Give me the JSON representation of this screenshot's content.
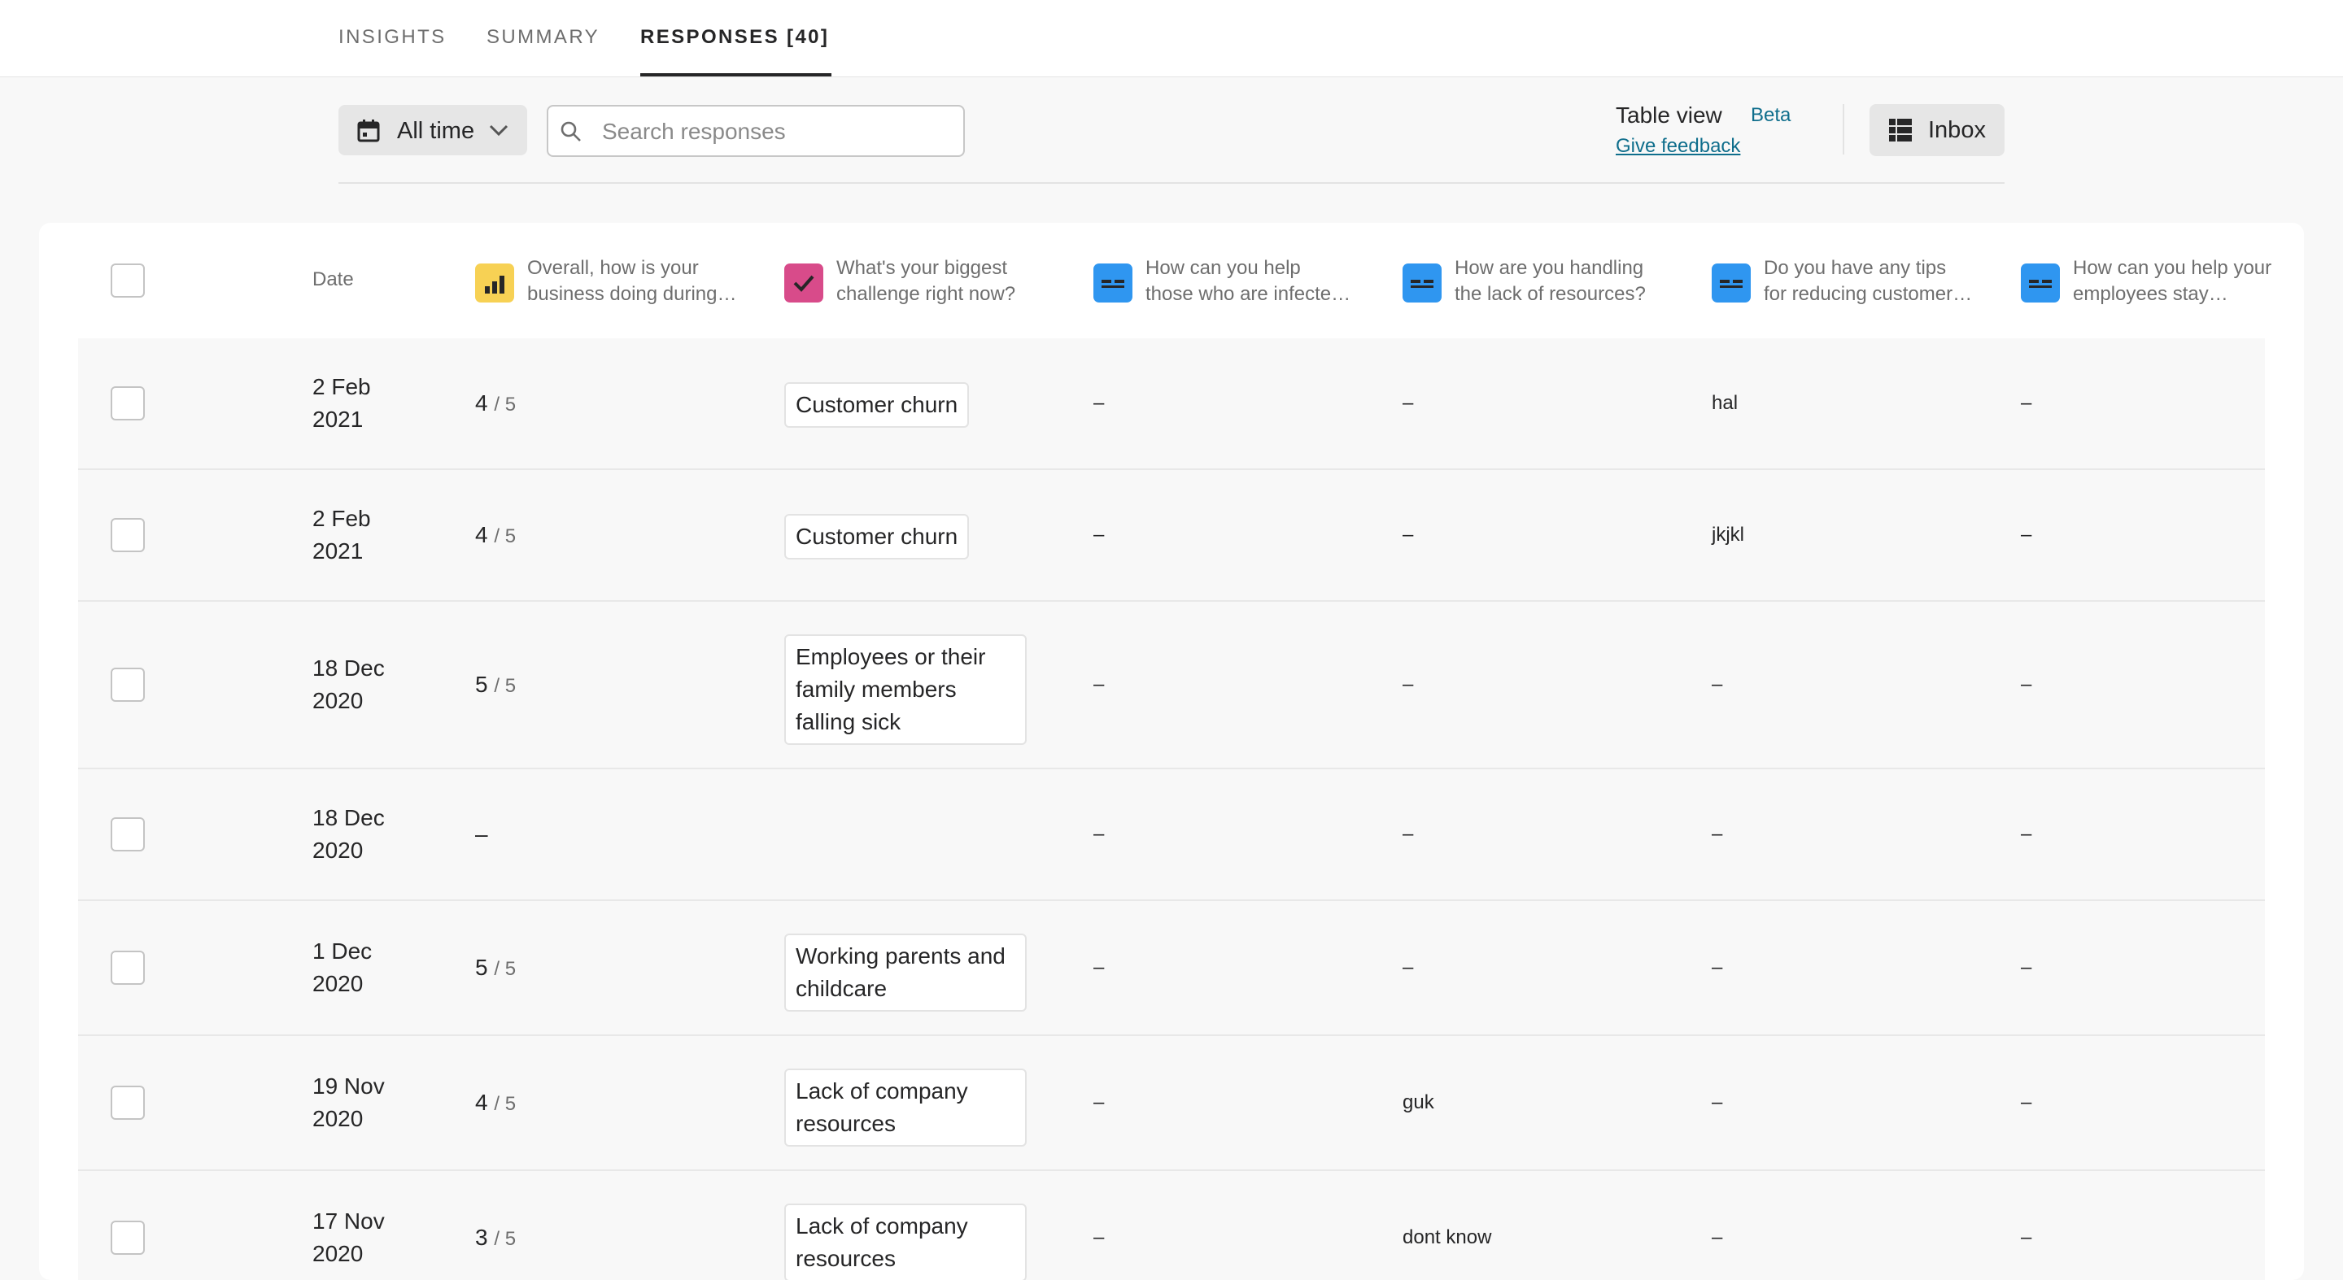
{
  "tabs": [
    {
      "label": "INSIGHTS",
      "active": false
    },
    {
      "label": "SUMMARY",
      "active": false
    },
    {
      "label": "RESPONSES [40]",
      "active": true
    }
  ],
  "toolbar": {
    "date_filter_label": "All time",
    "search_placeholder": "Search responses",
    "table_view_label": "Table view",
    "beta_label": "Beta",
    "feedback_link": "Give feedback",
    "inbox_label": "Inbox"
  },
  "table": {
    "date_header": "Date",
    "questions": [
      {
        "line1": "Overall, how is your",
        "line2": "business doing during…",
        "icon": "rating-chart-icon",
        "color": "#f7d154"
      },
      {
        "line1": "What's your biggest",
        "line2": "challenge right now?",
        "icon": "checkbox-check-icon",
        "color": "#d84b8a"
      },
      {
        "line1": "How can you help",
        "line2": "those who are infecte…",
        "icon": "short-text-icon",
        "color": "#2f96f0"
      },
      {
        "line1": "How are you handling",
        "line2": "the lack of resources?",
        "icon": "short-text-icon",
        "color": "#2f96f0"
      },
      {
        "line1": "Do you have any tips",
        "line2": "for reducing customer…",
        "icon": "short-text-icon",
        "color": "#2f96f0"
      },
      {
        "line1": "How can you help your",
        "line2": "employees stay…",
        "icon": "short-text-icon",
        "color": "#2f96f0"
      }
    ],
    "rows": [
      {
        "date1": "2 Feb",
        "date2": "2021",
        "rating": "4",
        "rating_den": "/ 5",
        "choice": [
          "Customer churn"
        ],
        "q3": "–",
        "q4": "–",
        "q5": "hal",
        "q6": "–"
      },
      {
        "date1": "2 Feb",
        "date2": "2021",
        "rating": "4",
        "rating_den": "/ 5",
        "choice": [
          "Customer churn"
        ],
        "q3": "–",
        "q4": "–",
        "q5": "jkjkl",
        "q6": "–"
      },
      {
        "date1": "18 Dec",
        "date2": "2020",
        "rating": "5",
        "rating_den": "/ 5",
        "choice": [
          "Employees or their",
          "family members",
          "falling sick"
        ],
        "q3": "–",
        "q4": "–",
        "q5": "–",
        "q6": "–"
      },
      {
        "date1": "18 Dec",
        "date2": "2020",
        "rating": "–",
        "rating_den": "",
        "choice": [],
        "q3": "–",
        "q4": "–",
        "q5": "–",
        "q6": "–"
      },
      {
        "date1": "1 Dec",
        "date2": "2020",
        "rating": "5",
        "rating_den": "/ 5",
        "choice": [
          "Working parents and",
          "childcare"
        ],
        "q3": "–",
        "q4": "–",
        "q5": "–",
        "q6": "–"
      },
      {
        "date1": "19 Nov",
        "date2": "2020",
        "rating": "4",
        "rating_den": "/ 5",
        "choice": [
          "Lack of company",
          "resources"
        ],
        "q3": "–",
        "q4": "guk",
        "q5": "–",
        "q6": "–"
      },
      {
        "date1": "17 Nov",
        "date2": "2020",
        "rating": "3",
        "rating_den": "/ 5",
        "choice": [
          "Lack of company",
          "resources"
        ],
        "q3": "–",
        "q4": "dont know",
        "q5": "–",
        "q6": "–"
      }
    ]
  }
}
